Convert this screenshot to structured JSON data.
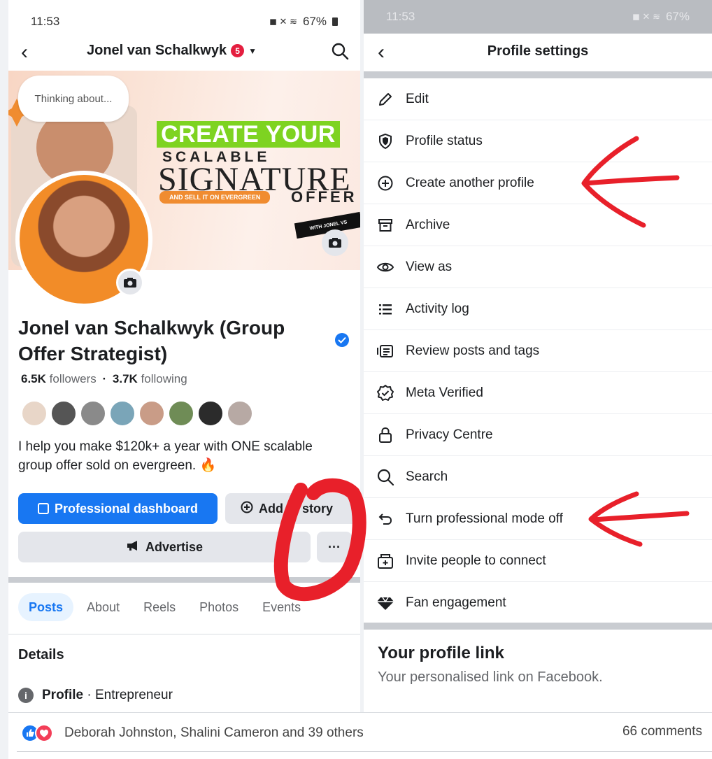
{
  "left": {
    "status": {
      "time": "11:53",
      "battery": "67%"
    },
    "header": {
      "title": "Jonel van Schalkwyk",
      "badge": "5"
    },
    "cover": {
      "thinking": "Thinking about...",
      "line1": "CREATE YOUR",
      "line2": "SCALABLE",
      "line3": "SIGNATURE",
      "line4": "AND SELL IT ON EVERGREEN",
      "line5": "OFFER",
      "tag": "WITH JONEL VS"
    },
    "profile": {
      "name": "Jonel van Schalkwyk (Group Offer Strategist)",
      "followers_count": "6.5K",
      "followers_label": "followers",
      "separator": "·",
      "following_count": "3.7K",
      "following_label": "following",
      "bio": "I help you make $120k+ a year with ONE scalable group offer sold on evergreen. 🔥"
    },
    "buttons": {
      "dashboard": "Professional dashboard",
      "add_to_story": "Add to story",
      "advertise": "Advertise",
      "more": "···"
    },
    "tabs": [
      "Posts",
      "About",
      "Reels",
      "Photos",
      "Events"
    ],
    "details": {
      "heading": "Details",
      "profile_label": "Profile",
      "profile_value": "· Entrepreneur"
    }
  },
  "right": {
    "status": {
      "time": "11:53",
      "battery": "67%"
    },
    "header": {
      "title": "Profile settings"
    },
    "menu": [
      {
        "label": "Edit",
        "icon": "pencil-icon"
      },
      {
        "label": "Profile status",
        "icon": "shield-icon"
      },
      {
        "label": "Create another profile",
        "icon": "plus-circle-icon"
      },
      {
        "label": "Archive",
        "icon": "archive-icon"
      },
      {
        "label": "View as",
        "icon": "eye-icon"
      },
      {
        "label": "Activity log",
        "icon": "list-icon"
      },
      {
        "label": "Review posts and tags",
        "icon": "review-icon"
      },
      {
        "label": "Meta Verified",
        "icon": "verified-badge-icon"
      },
      {
        "label": "Privacy Centre",
        "icon": "lock-icon"
      },
      {
        "label": "Search",
        "icon": "search-icon"
      },
      {
        "label": "Turn professional mode off",
        "icon": "undo-icon"
      },
      {
        "label": "Invite people to connect",
        "icon": "invite-icon"
      },
      {
        "label": "Fan engagement",
        "icon": "diamond-icon"
      }
    ],
    "profile_link": {
      "heading": "Your profile link",
      "subtitle": "Your personalised link on Facebook."
    }
  },
  "bottom": {
    "reactions_text": "Deborah Johnston, Shalini Cameron and 39 others",
    "comments": "66 comments"
  },
  "colors": {
    "facebook_blue": "#1877f2",
    "annotation_red": "#e8202a",
    "cover_green": "#7ed321",
    "cover_orange": "#f08c30"
  }
}
